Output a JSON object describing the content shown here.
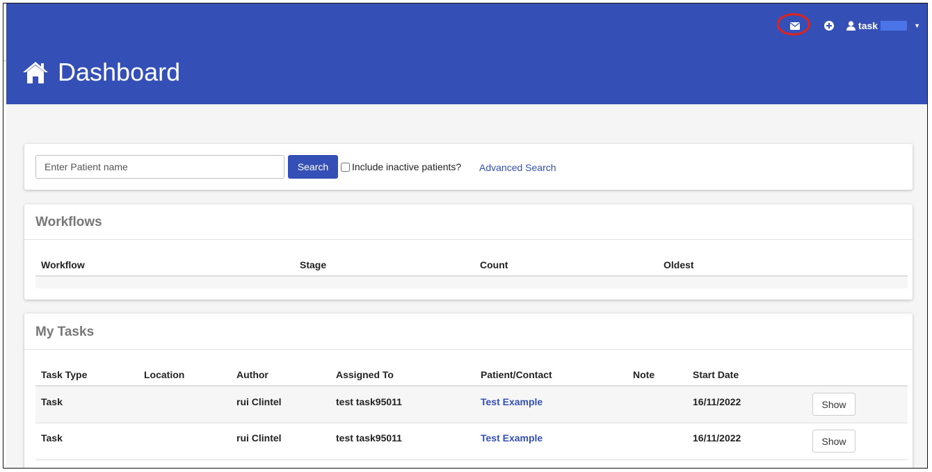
{
  "header": {
    "title": "Dashboard",
    "user_name": "task",
    "icons": {
      "home": "home-icon",
      "mail": "envelope-icon",
      "add": "plus-circle-icon",
      "user": "user-icon",
      "caret": "caret-down-icon"
    },
    "colors": {
      "primary": "#3450b6",
      "highlight_ring": "#e0221b"
    }
  },
  "search": {
    "placeholder": "Enter Patient name",
    "button_label": "Search",
    "inactive_label": "Include inactive patients?",
    "advanced_label": "Advanced Search"
  },
  "workflows": {
    "title": "Workflows",
    "columns": [
      "Workflow",
      "Stage",
      "Count",
      "Oldest"
    ]
  },
  "tasks": {
    "title": "My Tasks",
    "columns": [
      "Task Type",
      "Location",
      "Author",
      "Assigned To",
      "Patient/Contact",
      "Note",
      "Start Date"
    ],
    "rows": [
      {
        "type": "Task",
        "location": "",
        "author": "rui Clintel",
        "assigned": "test task95011",
        "patient": "Test Example",
        "note": "",
        "date": "16/11/2022",
        "action": "Show"
      },
      {
        "type": "Task",
        "location": "",
        "author": "rui Clintel",
        "assigned": "test task95011",
        "patient": "Test Example",
        "note": "",
        "date": "16/11/2022",
        "action": "Show"
      }
    ]
  }
}
